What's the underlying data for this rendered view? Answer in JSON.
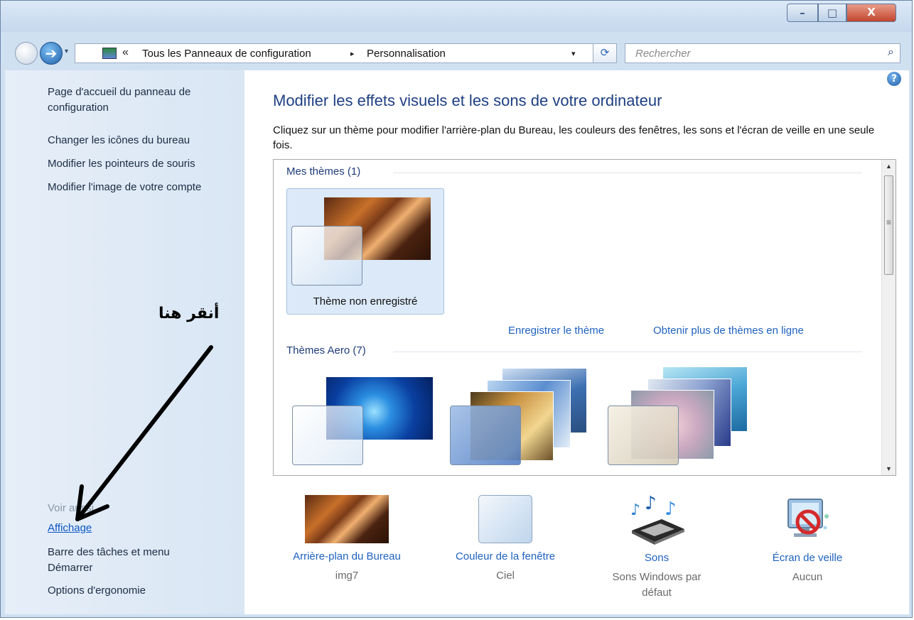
{
  "window": {
    "controls": {
      "minimize": "–",
      "maximize": "□",
      "close": "X"
    }
  },
  "navbar": {
    "back_icon": "back-arrow-icon",
    "forward_icon": "forward-arrow-icon",
    "breadcrumb_prefix": "«",
    "breadcrumb": [
      "Tous les Panneaux de configuration",
      "Personnalisation"
    ],
    "breadcrumb_separator": "▸",
    "dropdown": "▾",
    "refresh": "⟳",
    "search_placeholder": "Rechercher",
    "search_icon": "⌕"
  },
  "sidebar": {
    "links": [
      {
        "label": "Page d'accueil du panneau de configuration"
      },
      {
        "label": "Changer les icônes du bureau"
      },
      {
        "label": "Modifier les pointeurs de souris"
      },
      {
        "label": "Modifier l'image de votre compte"
      }
    ],
    "see_also_title": "Voir aussi",
    "see_also": [
      {
        "label": "Affichage"
      },
      {
        "label": "Barre des tâches et menu Démarrer"
      },
      {
        "label": "Options d'ergonomie"
      }
    ]
  },
  "main": {
    "help": "?",
    "title": "Modifier les effets visuels et les sons de votre ordinateur",
    "description": "Cliquez sur un thème pour modifier l'arrière-plan du Bureau, les couleurs des fenêtres, les sons et l'écran de veille en une seule fois.",
    "my_themes_header": "Mes thèmes (1)",
    "my_themes": [
      {
        "label": "Thème non enregistré"
      }
    ],
    "save_theme_link": "Enregistrer le thème",
    "more_themes_link": "Obtenir plus de thèmes en ligne",
    "aero_header": "Thèmes Aero (7)"
  },
  "bottom": [
    {
      "label": "Arrière-plan du Bureau",
      "sub": "img7"
    },
    {
      "label": "Couleur de la fenêtre",
      "sub": "Ciel"
    },
    {
      "label": "Sons",
      "sub": "Sons Windows par défaut"
    },
    {
      "label": "Écran de veille",
      "sub": "Aucun"
    }
  ],
  "annotation": {
    "text": "أنقر هنا"
  },
  "colors": {
    "link": "#1f62bf",
    "title": "#1e3f83",
    "sidebar_bg": "#dfe9f5"
  }
}
